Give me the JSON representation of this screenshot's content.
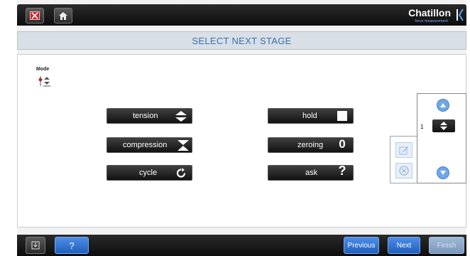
{
  "topbar": {
    "brand": "Chatillon",
    "brand_sub": "force measurement"
  },
  "titlebar": {
    "title": "SELECT NEXT STAGE"
  },
  "mode": {
    "label": "Mode"
  },
  "stages": {
    "tension": "tension",
    "compression": "compression",
    "cycle": "cycle",
    "hold": "hold",
    "zeroing": "zeroing",
    "zeroing_glyph": "0",
    "ask": "ask",
    "ask_glyph": "?"
  },
  "stepper": {
    "value": "1"
  },
  "bottombar": {
    "help_label": "?",
    "previous_label": "Previous",
    "next_label": "Next",
    "finish_label": "Finish"
  },
  "colors": {
    "accent_blue": "#3a6fb0",
    "button_dark": "#121212",
    "bar_dark": "#0d0d0d"
  }
}
